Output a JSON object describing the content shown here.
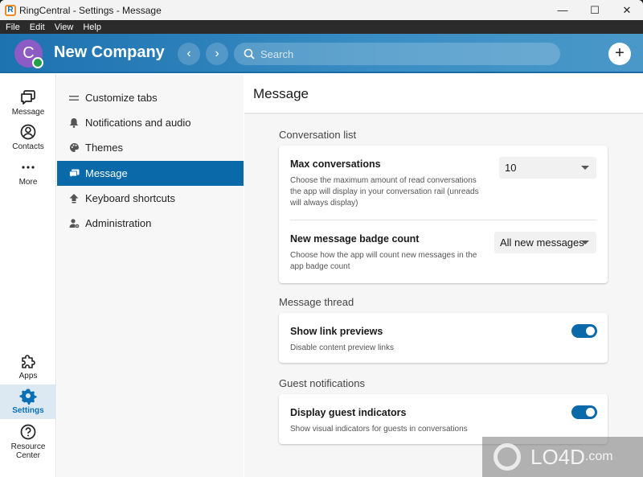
{
  "window": {
    "title": "RingCentral - Settings - Message",
    "logo_letter": "R",
    "controls": {
      "minimize": "—",
      "maximize": "☐",
      "close": "✕"
    }
  },
  "menu": [
    "File",
    "Edit",
    "View",
    "Help"
  ],
  "header": {
    "avatar_letter": "C",
    "company": "New Company",
    "back": "‹",
    "forward": "›",
    "search_placeholder": "Search",
    "add": "+"
  },
  "rail": {
    "top": [
      {
        "label": "Message",
        "icon": "message-icon"
      },
      {
        "label": "Contacts",
        "icon": "contacts-icon"
      },
      {
        "label": "More",
        "icon": "more-icon"
      }
    ],
    "bottom": [
      {
        "label": "Apps",
        "icon": "apps-icon"
      },
      {
        "label": "Settings",
        "icon": "settings-icon",
        "active": true
      },
      {
        "label": "Resource Center",
        "label_line1": "Resource",
        "label_line2": "Center",
        "icon": "help-icon"
      }
    ]
  },
  "settings_nav": [
    {
      "label": "Customize tabs",
      "icon": "customize-icon"
    },
    {
      "label": "Notifications and audio",
      "icon": "bell-icon"
    },
    {
      "label": "Themes",
      "icon": "palette-icon"
    },
    {
      "label": "Message",
      "icon": "message-icon",
      "active": true
    },
    {
      "label": "Keyboard shortcuts",
      "icon": "keyboard-icon"
    },
    {
      "label": "Administration",
      "icon": "admin-icon"
    }
  ],
  "content": {
    "title": "Message",
    "sections": [
      {
        "label": "Conversation list",
        "rows": [
          {
            "title": "Max conversations",
            "desc": "Choose the maximum amount of read conversations the app will display in your conversation rail (unreads will always display)",
            "control": "select",
            "value": "10"
          },
          {
            "title": "New message badge count",
            "desc": "Choose how the app will count new messages in the app badge count",
            "control": "select",
            "value": "All new messages"
          }
        ]
      },
      {
        "label": "Message thread",
        "rows": [
          {
            "title": "Show link previews",
            "desc": "Disable content preview links",
            "control": "toggle",
            "value": true
          }
        ]
      },
      {
        "label": "Guest notifications",
        "rows": [
          {
            "title": "Display guest indicators",
            "desc": "Show visual indicators for guests in conversations",
            "control": "toggle",
            "value": true
          }
        ]
      }
    ]
  },
  "watermark": {
    "main": "LO4D",
    "suffix": ".com"
  },
  "colors": {
    "accent": "#0a6aa9",
    "header": "#1d72b0",
    "avatar": "#8d5bc4",
    "presence": "#22a04b"
  }
}
